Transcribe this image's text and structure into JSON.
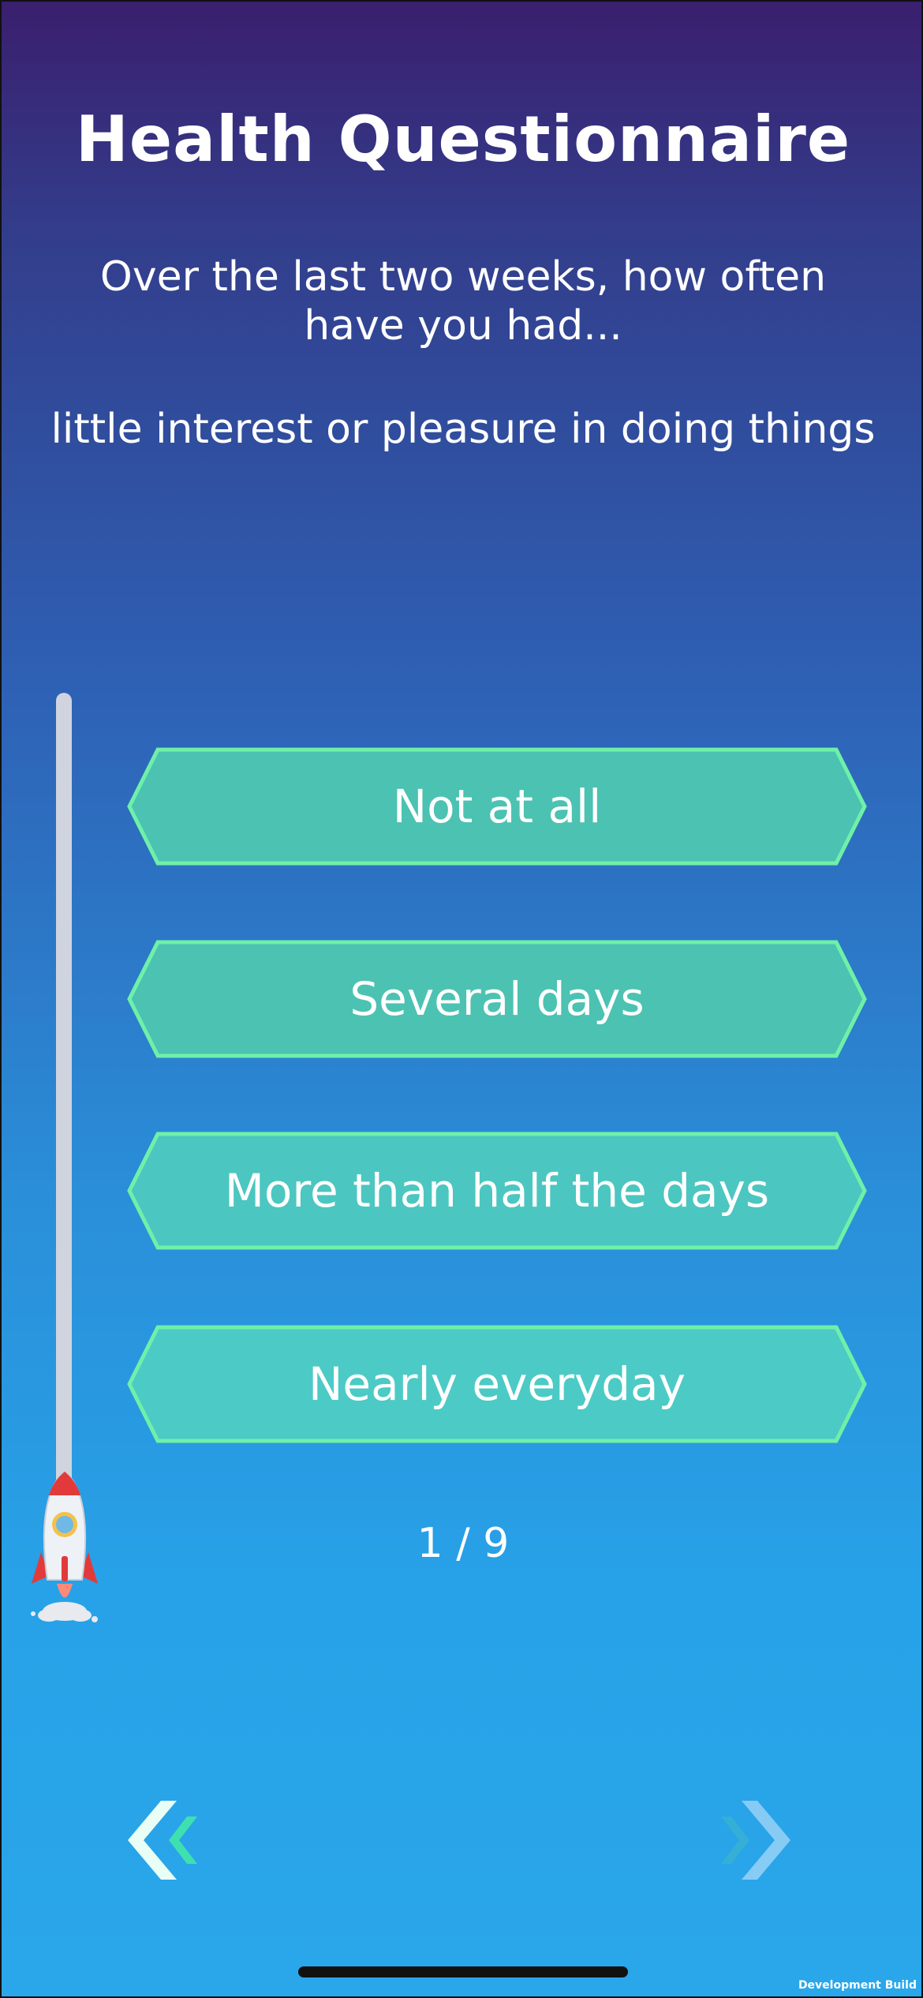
{
  "header": {
    "title": "Health Questionnaire",
    "prompt": "Over the last two weeks, how often have you had...",
    "symptom": "little interest or pleasure in doing things"
  },
  "options": [
    {
      "label": "Not at all"
    },
    {
      "label": "Several days"
    },
    {
      "label": "More than half the days"
    },
    {
      "label": "Nearly everyday"
    }
  ],
  "progress": {
    "current": 1,
    "total": 9,
    "label": "1 / 9"
  },
  "navigation": {
    "back_icon": "double-chevron-left-icon",
    "next_icon": "double-chevron-right-icon"
  },
  "footer": {
    "build_label": "Development Build"
  },
  "colors": {
    "option_fill": "#4cc2b2",
    "option_border": "#6ff0a8",
    "track": "#cfd4de",
    "text": "#ffffff"
  }
}
